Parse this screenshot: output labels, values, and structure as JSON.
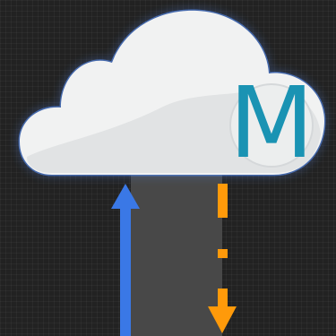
{
  "icon": {
    "letter": "M",
    "name": "cloud-sync-icon"
  },
  "colors": {
    "background": "#222222",
    "cloud_fill": "#f1f2f2",
    "cloud_shadow": "#cfd3d6",
    "cloud_glow": "#4f7fd8",
    "letter": "#1a93b3",
    "upload_arrow": "#3a78e6",
    "download_arrow": "#ff9a0a",
    "channel": "#484848"
  }
}
